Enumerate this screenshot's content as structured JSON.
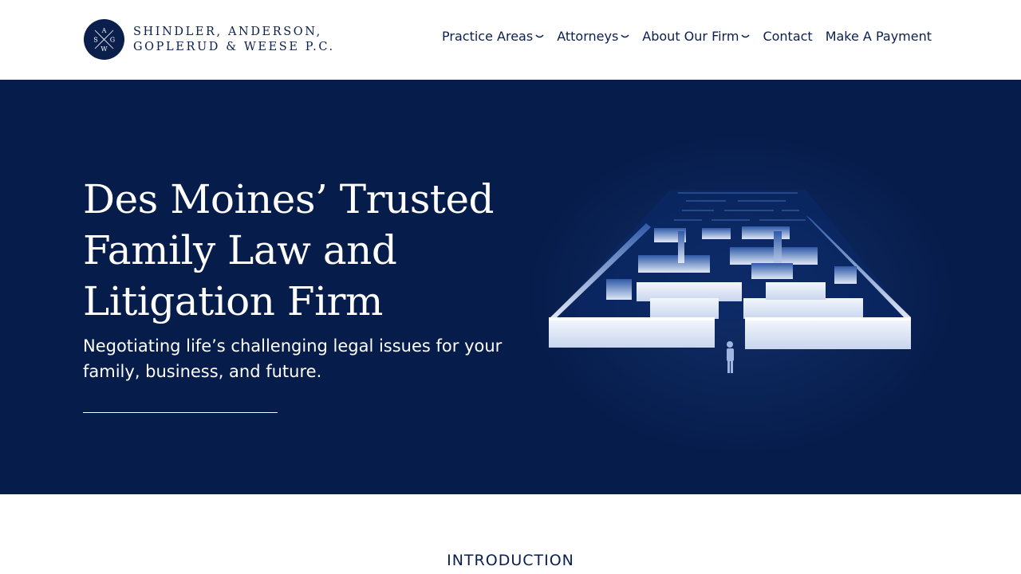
{
  "brand": {
    "monogram": [
      "A",
      "S",
      "G",
      "W"
    ],
    "line1": "SHINDLER, ANDERSON,",
    "line2": "GOPLERUD & WEESE P.C."
  },
  "nav": {
    "items": [
      {
        "label": "Practice Areas",
        "dropdown": true
      },
      {
        "label": "Attorneys",
        "dropdown": true
      },
      {
        "label": "About Our Firm",
        "dropdown": true
      },
      {
        "label": "Contact",
        "dropdown": false
      },
      {
        "label": "Make A Payment",
        "dropdown": false
      }
    ]
  },
  "hero": {
    "title": "Des Moines’ Trusted Family Law and Litigation Firm",
    "subtitle": "Negotiating life’s challenging legal issues for your family, business, and future.",
    "image_icon": "maze-illustration"
  },
  "intro": {
    "label": "INTRODUCTION"
  },
  "colors": {
    "navy": "#061c4a",
    "text_dark": "#0b1f4d",
    "white": "#ffffff",
    "maze_light": "#dfe7f5"
  }
}
